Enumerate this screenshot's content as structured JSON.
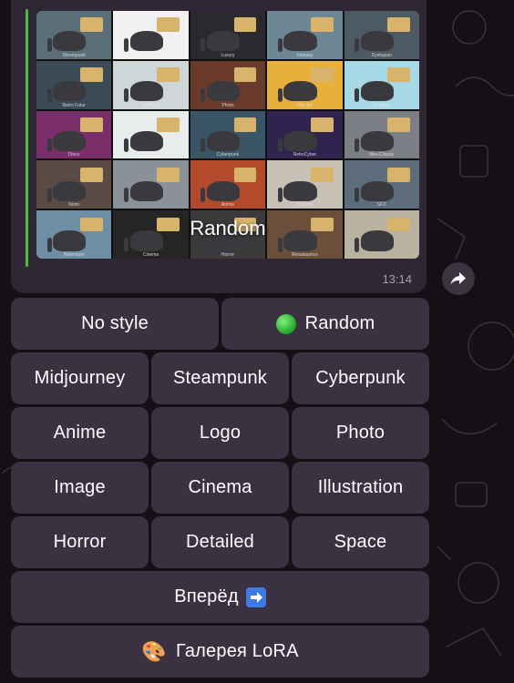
{
  "gallery": {
    "overlay_label": "Random",
    "time": "13:14",
    "captions": [
      [
        "Steampunk",
        "Line Art",
        "Luxury",
        "Fantasy",
        "Dystopian"
      ],
      [
        "Retro Futur",
        "Minimal",
        "Photo",
        "Pop Art",
        "Graphic"
      ],
      [
        "Disco",
        "Architecture",
        "Cyberpunk",
        "RetroCyber",
        "Neo-Classic"
      ],
      [
        "Neon",
        "",
        "Anime",
        "Custom",
        "SFX"
      ],
      [
        "Adventure",
        "Cinema",
        "Horror",
        "Renaissance",
        ""
      ]
    ],
    "tile_colors": [
      [
        "#5b6f78",
        "#f1f1f1",
        "#2a2a2e",
        "#6e8794",
        "#4e5a63"
      ],
      [
        "#3b4a54",
        "#cfd6d8",
        "#6a3b2a",
        "#e7b03b",
        "#a6d8e6"
      ],
      [
        "#7a2f6b",
        "#e9ecec",
        "#3a5566",
        "#2f2350",
        "#7b7e84"
      ],
      [
        "#5a4c45",
        "#8a9198",
        "#b34a2c",
        "#c8c2b6",
        "#5d6d7c"
      ],
      [
        "#6e8ea5",
        "#262526",
        "#3b3b3e",
        "#6a4f3a",
        "#b9b2a1"
      ]
    ]
  },
  "share_icon": "forward-arrow-icon",
  "keyboard": {
    "rows": [
      [
        "No style",
        "Random"
      ],
      [
        "Midjourney",
        "Steampunk",
        "Cyberpunk"
      ],
      [
        "Anime",
        "Logo",
        "Photo"
      ],
      [
        "Image",
        "Cinema",
        "Illustration"
      ],
      [
        "Horror",
        "Detailed",
        "Space"
      ],
      [
        "Вперёд"
      ],
      [
        "Галерея LoRA"
      ]
    ],
    "random_icon": "green-circle-icon",
    "forward_icon": "right-arrow-icon",
    "gallery_icon": "palette-icon"
  }
}
